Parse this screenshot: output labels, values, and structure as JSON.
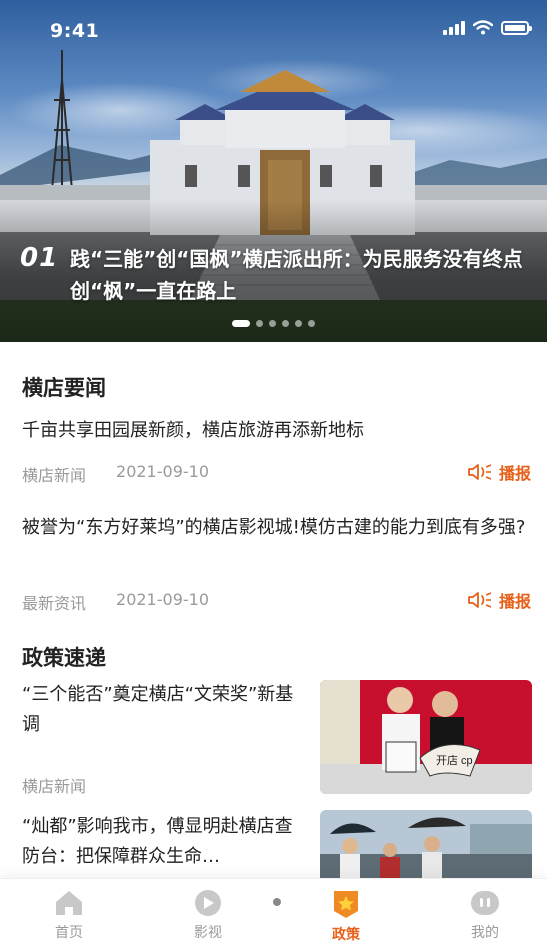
{
  "status_bar": {
    "time": "9:41"
  },
  "hero": {
    "index": "01",
    "title": "践“三能”创“国枫”横店派出所：为民服务没有终点 创“枫”一直在路上",
    "slide_count": 6,
    "active_slide": 1
  },
  "section_news": {
    "title": "横店要闻",
    "items": [
      {
        "title": "千亩共享田园展新颜，横店旅游再添新地标",
        "source": "横店新闻",
        "date": "2021-09-10",
        "play_label": "播报"
      },
      {
        "title": "被誉为“东方好莱坞”的横店影视城!模仿古建的能力到底有多强?",
        "source": "最新资讯",
        "date": "2021-09-10",
        "play_label": "播报"
      }
    ]
  },
  "section_policy": {
    "title": "政策速递",
    "items": [
      {
        "title": "“三个能否”奠定横店“文荣奖”新基调",
        "source": "横店新闻",
        "thumb_text": "开店 cp"
      },
      {
        "title": "“灿都”影响我市，傅显明赴横店查防台：把保障群众生命…",
        "source": ""
      }
    ]
  },
  "tabbar": {
    "tabs": [
      {
        "label": "首页",
        "icon": "home-icon",
        "active": false
      },
      {
        "label": "影视",
        "icon": "video-icon",
        "active": false
      },
      {
        "label": "政策",
        "icon": "policy-star-icon",
        "active": true
      },
      {
        "label": "我的",
        "icon": "profile-icon",
        "active": false
      }
    ]
  },
  "colors": {
    "accent": "#e8611b",
    "muted": "#9a9a9a",
    "text": "#222222"
  }
}
